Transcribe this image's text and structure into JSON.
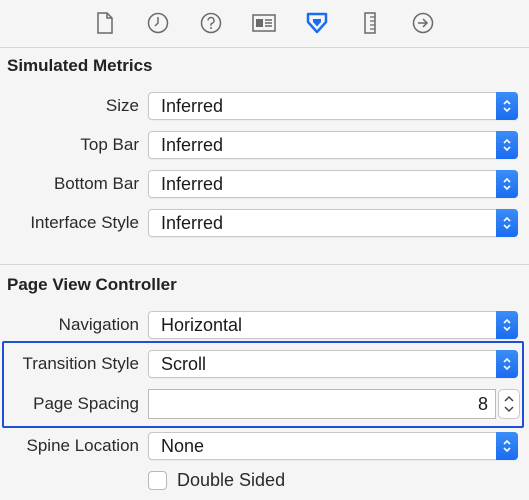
{
  "toolbar": {
    "icons": [
      "file-inspector-icon",
      "history-icon",
      "help-icon",
      "identity-icon",
      "attributes-inspector-icon",
      "size-inspector-icon",
      "connections-icon"
    ],
    "active_icon": "attributes-inspector-icon",
    "accent": "#1a6cf0"
  },
  "simulated_metrics": {
    "title": "Simulated Metrics",
    "rows": [
      {
        "label": "Size",
        "value": "Inferred"
      },
      {
        "label": "Top Bar",
        "value": "Inferred"
      },
      {
        "label": "Bottom Bar",
        "value": "Inferred"
      },
      {
        "label": "Interface Style",
        "value": "Inferred"
      }
    ]
  },
  "page_view_controller": {
    "title": "Page View Controller",
    "navigation": {
      "label": "Navigation",
      "value": "Horizontal"
    },
    "transition_style": {
      "label": "Transition Style",
      "value": "Scroll"
    },
    "page_spacing": {
      "label": "Page Spacing",
      "value": "8"
    },
    "spine_location": {
      "label": "Spine Location",
      "value": "None"
    },
    "double_sided": {
      "label": "Double Sided",
      "checked": false
    }
  },
  "highlight_color": "#1f4fd6"
}
